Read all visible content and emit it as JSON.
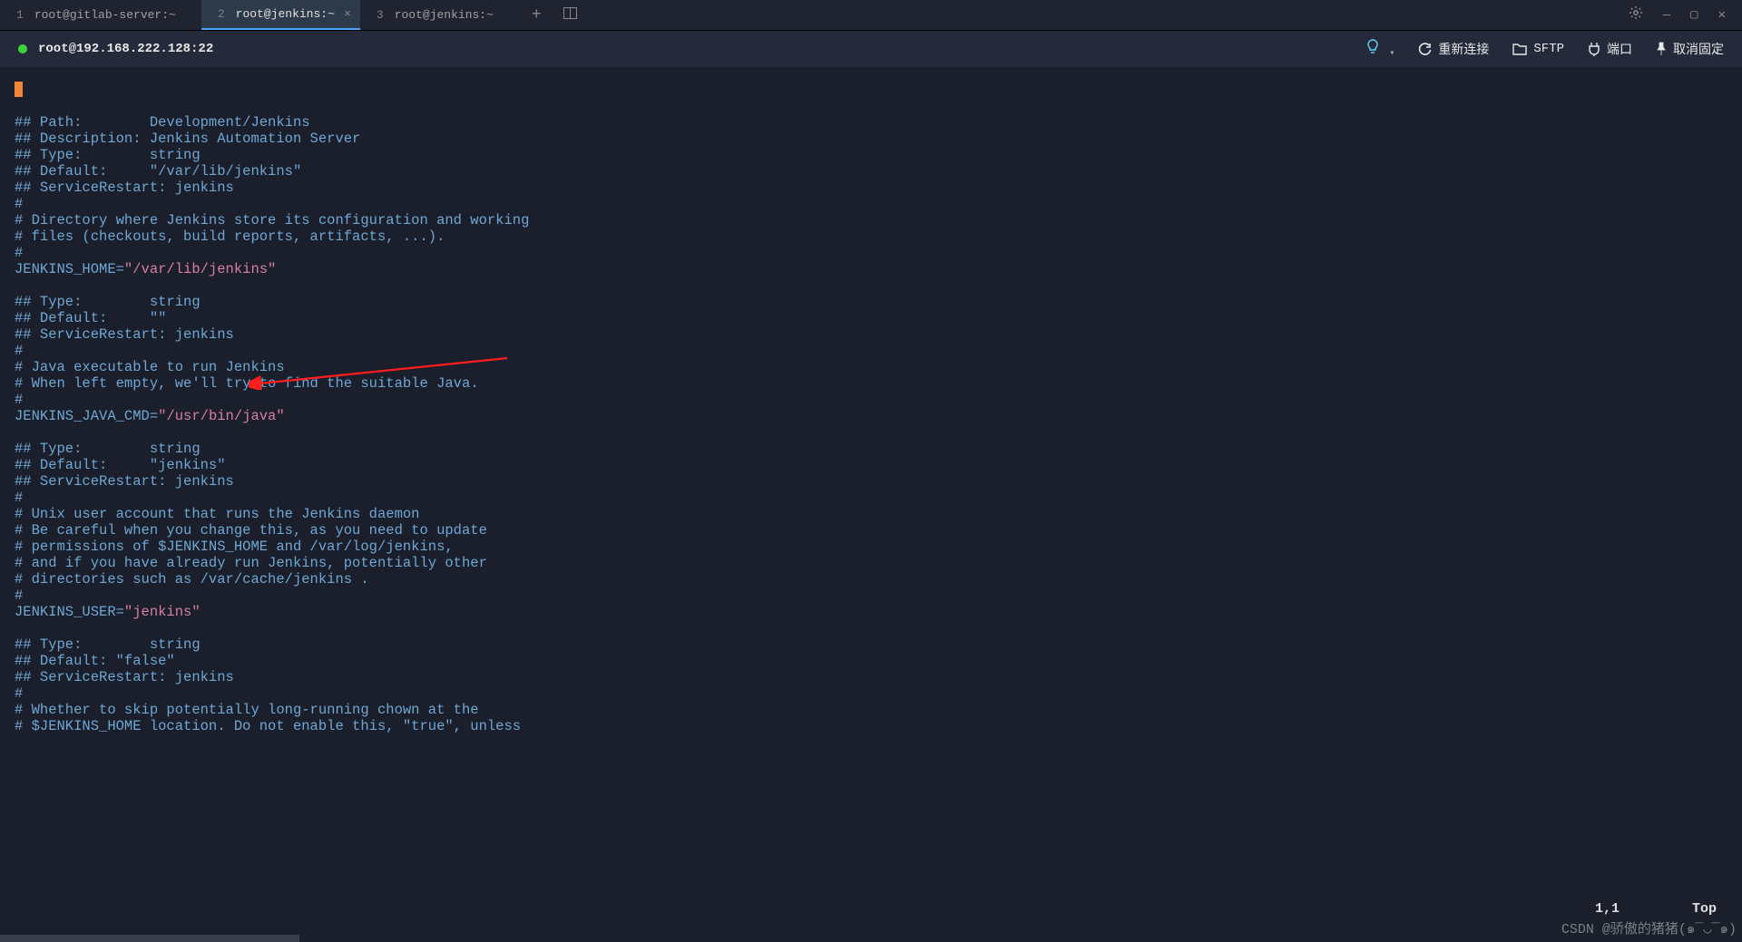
{
  "tabs": [
    {
      "num": "1",
      "title": "root@gitlab-server:~",
      "active": false
    },
    {
      "num": "2",
      "title": "root@jenkins:~",
      "active": true
    },
    {
      "num": "3",
      "title": "root@jenkins:~",
      "active": false
    }
  ],
  "window_controls": {
    "minimize": "—",
    "maximize": "▢",
    "close": "✕"
  },
  "toolbar": {
    "host": "root@192.168.222.128:22",
    "reconnect": "重新连接",
    "sftp": "SFTP",
    "port": "端口",
    "unpin": "取消固定"
  },
  "terminal_lines": [
    {
      "segments": [
        {
          "t": "## Path:        Development/Jenkins",
          "c": "plain"
        }
      ]
    },
    {
      "segments": [
        {
          "t": "## Description: Jenkins Automation Server",
          "c": "plain"
        }
      ]
    },
    {
      "segments": [
        {
          "t": "## Type:        string",
          "c": "plain"
        }
      ]
    },
    {
      "segments": [
        {
          "t": "## Default:     \"/var/lib/jenkins\"",
          "c": "plain"
        }
      ]
    },
    {
      "segments": [
        {
          "t": "## ServiceRestart: jenkins",
          "c": "plain"
        }
      ]
    },
    {
      "segments": [
        {
          "t": "#",
          "c": "plain"
        }
      ]
    },
    {
      "segments": [
        {
          "t": "# Directory where Jenkins store its configuration and working",
          "c": "plain"
        }
      ]
    },
    {
      "segments": [
        {
          "t": "# files (checkouts, build reports, artifacts, ...).",
          "c": "plain"
        }
      ]
    },
    {
      "segments": [
        {
          "t": "#",
          "c": "plain"
        }
      ]
    },
    {
      "segments": [
        {
          "t": "JENKINS_HOME=",
          "c": "plain"
        },
        {
          "t": "\"/var/lib/jenkins\"",
          "c": "str"
        }
      ]
    },
    {
      "segments": [
        {
          "t": "",
          "c": "plain"
        }
      ]
    },
    {
      "segments": [
        {
          "t": "## Type:        string",
          "c": "plain"
        }
      ]
    },
    {
      "segments": [
        {
          "t": "## Default:     \"\"",
          "c": "plain"
        }
      ]
    },
    {
      "segments": [
        {
          "t": "## ServiceRestart: jenkins",
          "c": "plain"
        }
      ]
    },
    {
      "segments": [
        {
          "t": "#",
          "c": "plain"
        }
      ]
    },
    {
      "segments": [
        {
          "t": "# Java executable to run Jenkins",
          "c": "plain"
        }
      ]
    },
    {
      "segments": [
        {
          "t": "# When left empty, we'll try to find the suitable Java.",
          "c": "plain"
        }
      ]
    },
    {
      "segments": [
        {
          "t": "#",
          "c": "plain"
        }
      ]
    },
    {
      "segments": [
        {
          "t": "JENKINS_JAVA_CMD=",
          "c": "plain"
        },
        {
          "t": "\"/usr/bin/java\"",
          "c": "str"
        }
      ]
    },
    {
      "segments": [
        {
          "t": "",
          "c": "plain"
        }
      ]
    },
    {
      "segments": [
        {
          "t": "## Type:        string",
          "c": "plain"
        }
      ]
    },
    {
      "segments": [
        {
          "t": "## Default:     \"jenkins\"",
          "c": "plain"
        }
      ]
    },
    {
      "segments": [
        {
          "t": "## ServiceRestart: jenkins",
          "c": "plain"
        }
      ]
    },
    {
      "segments": [
        {
          "t": "#",
          "c": "plain"
        }
      ]
    },
    {
      "segments": [
        {
          "t": "# Unix user account that runs the Jenkins daemon",
          "c": "plain"
        }
      ]
    },
    {
      "segments": [
        {
          "t": "# Be careful when you change this, as you need to update",
          "c": "plain"
        }
      ]
    },
    {
      "segments": [
        {
          "t": "# permissions of $JENKINS_HOME and /var/log/jenkins,",
          "c": "plain"
        }
      ]
    },
    {
      "segments": [
        {
          "t": "# and if you have already run Jenkins, potentially other",
          "c": "plain"
        }
      ]
    },
    {
      "segments": [
        {
          "t": "# directories such as /var/cache/jenkins .",
          "c": "plain"
        }
      ]
    },
    {
      "segments": [
        {
          "t": "#",
          "c": "plain"
        }
      ]
    },
    {
      "segments": [
        {
          "t": "JENKINS_USER=",
          "c": "plain"
        },
        {
          "t": "\"jenkins\"",
          "c": "str"
        }
      ]
    },
    {
      "segments": [
        {
          "t": "",
          "c": "plain"
        }
      ]
    },
    {
      "segments": [
        {
          "t": "## Type:        string",
          "c": "plain"
        }
      ]
    },
    {
      "segments": [
        {
          "t": "## Default: \"false\"",
          "c": "plain"
        }
      ]
    },
    {
      "segments": [
        {
          "t": "## ServiceRestart: jenkins",
          "c": "plain"
        }
      ]
    },
    {
      "segments": [
        {
          "t": "#",
          "c": "plain"
        }
      ]
    },
    {
      "segments": [
        {
          "t": "# Whether to skip potentially long-running chown at the",
          "c": "plain"
        }
      ]
    },
    {
      "segments": [
        {
          "t": "# $JENKINS_HOME location. Do not enable this, \"true\", unless",
          "c": "plain"
        }
      ]
    }
  ],
  "status": {
    "position": "1,1",
    "location": "Top"
  },
  "watermark": "CSDN @骄傲的猪猪(๑¯◡¯๑)"
}
